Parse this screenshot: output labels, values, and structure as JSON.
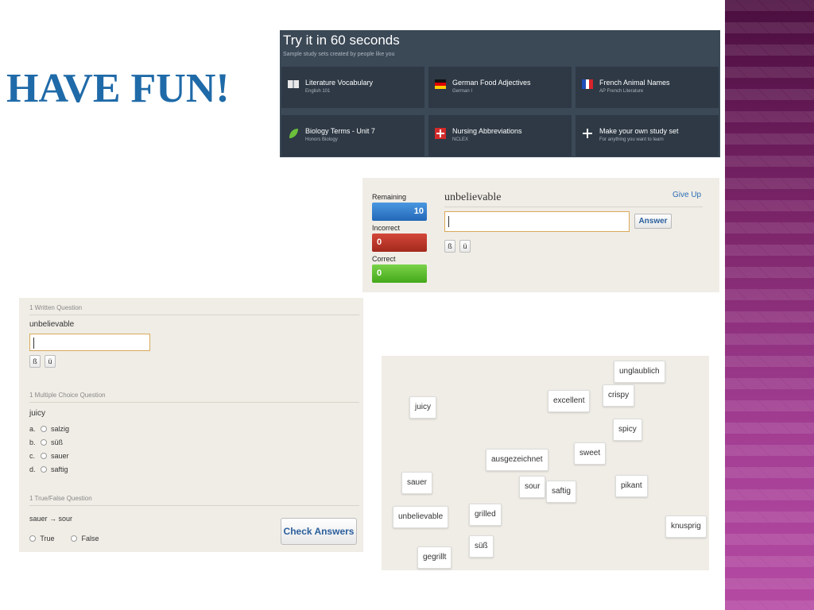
{
  "slide": {
    "title": "HAVE FUN!"
  },
  "try_panel": {
    "title": "Try it in 60 seconds",
    "subtitle": "Sample study sets created by people like you",
    "cards": [
      {
        "name": "Literature Vocabulary",
        "sub": "English 101",
        "icon": "book-icon"
      },
      {
        "name": "German Food Adjectives",
        "sub": "German I",
        "icon": "german-flag-icon"
      },
      {
        "name": "French Animal Names",
        "sub": "AP French Literature",
        "icon": "french-flag-icon"
      },
      {
        "name": "Biology Terms - Unit 7",
        "sub": "Honors Biology",
        "icon": "leaf-icon"
      },
      {
        "name": "Nursing Abbreviations",
        "sub": "NCLEX",
        "icon": "red-cross-icon"
      },
      {
        "name": "Make your own study set",
        "sub": "For anything you want to learn",
        "icon": "plus-icon"
      }
    ]
  },
  "learn": {
    "remaining_label": "Remaining",
    "remaining_value": "10",
    "incorrect_label": "Incorrect",
    "incorrect_value": "0",
    "correct_label": "Correct",
    "correct_value": "0",
    "word": "unbelievable",
    "give_up": "Give Up",
    "answer_button": "Answer",
    "answer_value": "",
    "special_chars": [
      "ß",
      "ü"
    ]
  },
  "test": {
    "written_header": "1 Written Question",
    "written_prompt": "unbelievable",
    "written_value": "",
    "special_chars": [
      "ß",
      "ü"
    ],
    "mc_header": "1 Multiple Choice Question",
    "mc_prompt": "juicy",
    "mc_options": [
      {
        "letter": "a.",
        "text": "salzig"
      },
      {
        "letter": "b.",
        "text": "süß"
      },
      {
        "letter": "c.",
        "text": "sauer"
      },
      {
        "letter": "d.",
        "text": "saftig"
      }
    ],
    "tf_header": "1 True/False Question",
    "tf_prompt": "sauer → sour",
    "tf_true": "True",
    "tf_false": "False",
    "check_button": "Check Answers"
  },
  "match": {
    "tiles": [
      "unglaublich",
      "crispy",
      "excellent",
      "juicy",
      "spicy",
      "sweet",
      "ausgezeichnet",
      "sauer",
      "sour",
      "saftig",
      "pikant",
      "grilled",
      "unbelievable",
      "knusprig",
      "süß",
      "gegrillt"
    ]
  },
  "colors": {
    "title_blue": "#1f6aa8",
    "remaining_blue": "#2f7fd0",
    "incorrect_red": "#c0392b",
    "correct_green": "#4caf1f",
    "panel_dark": "#3b4856",
    "link_blue": "#2a6db4"
  }
}
